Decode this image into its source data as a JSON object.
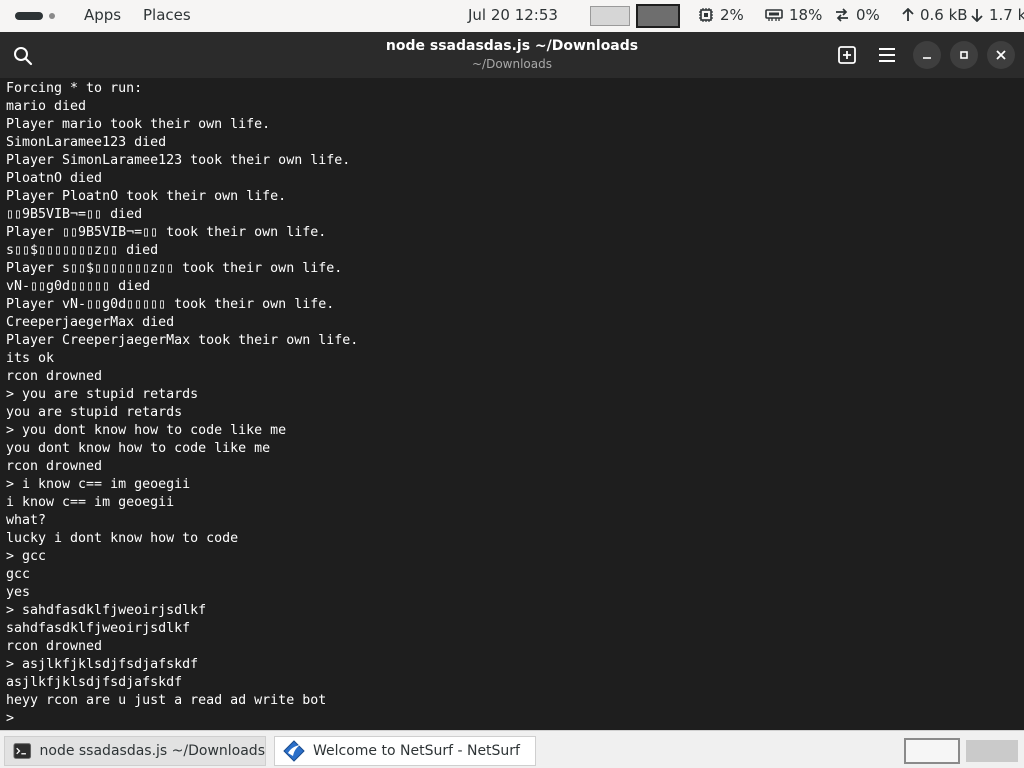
{
  "top_panel": {
    "apps_label": "Apps",
    "places_label": "Places",
    "clock": "Jul 20  12:53",
    "cpu": "2%",
    "memory": "18%",
    "swap": "0%",
    "upload": "0.6 kB",
    "download": "1.7 kB"
  },
  "window": {
    "title": "node ssadasdas.js ~/Downloads",
    "subtitle": "~/Downloads"
  },
  "terminal": {
    "lines": [
      "Forcing * to run:",
      "mario died",
      "Player mario took their own life.",
      "SimonLaramee123 died",
      "Player SimonLaramee123 took their own life.",
      "PloatnO died",
      "Player PloatnO took their own life.",
      "▯▯9B5VIB¬=▯▯ died",
      "Player ▯▯9B5VIB¬=▯▯ took their own life.",
      "s▯▯$▯▯▯▯▯▯▯z▯▯ died",
      "Player s▯▯$▯▯▯▯▯▯▯z▯▯ took their own life.",
      "vN-▯▯g0d▯▯▯▯▯ died",
      "Player vN-▯▯g0d▯▯▯▯▯ took their own life.",
      "CreeperjaegerMax died",
      "Player CreeperjaegerMax took their own life.",
      "its ok",
      "rcon drowned",
      "> you are stupid retards",
      "you are stupid retards",
      "> you dont know how to code like me",
      "you dont know how to code like me",
      "rcon drowned",
      "> i know c== im geoegii",
      "i know c== im geoegii",
      "what?",
      "lucky i dont know how to code",
      "> gcc",
      "gcc",
      "yes",
      "> sahdfasdklfjweoirjsdlkf",
      "sahdfasdklfjweoirjsdlkf",
      "rcon drowned",
      "> asjlkfjklsdjfsdjafskdf",
      "asjlkfjklsdjfsdjafskdf",
      "heyy rcon are u just a read ad write bot",
      ">"
    ]
  },
  "taskbar": {
    "items": [
      {
        "label": "node ssadasdas.js ~/Downloads",
        "icon": "terminal-icon"
      },
      {
        "label": "Welcome to NetSurf - NetSurf",
        "icon": "netsurf-icon"
      }
    ]
  },
  "colors": {
    "panel_bg": "#f6f5f4",
    "header_bg": "#2b2b2b",
    "terminal_bg": "#1e1e1e",
    "terminal_fg": "#ffffff",
    "taskbar_bg": "#f0f0f0"
  }
}
